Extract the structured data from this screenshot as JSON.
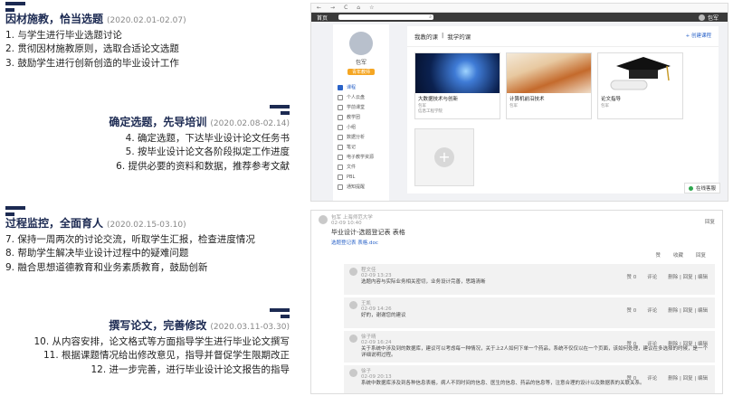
{
  "phases": [
    {
      "title": "因材施教，恰当选题",
      "date": "(2020.02.01-02.07)",
      "items": [
        "1. 与学生进行毕业选题讨论",
        "2. 贯彻因材施教原则，选取合适论文选题",
        "3. 鼓励学生进行创新创造的毕业设计工作"
      ]
    },
    {
      "title": "确定选题，先导培训",
      "date": "(2020.02.08-02.14)",
      "items": [
        "4. 确定选题，下达毕业设计论文任务书",
        "5. 按毕业设计论文各阶段拟定工作进度",
        "6. 提供必要的资料和数据，推荐参考文献"
      ]
    },
    {
      "title": "过程监控，全面育人",
      "date": "(2020.02.15-03.10)",
      "items": [
        "7. 保持一周两次的讨论交流，听取学生汇报，检查进度情况",
        "8. 帮助学生解决毕业设计过程中的疑难问题",
        "9. 融合思想道德教育和业务素质教育，鼓励创新"
      ]
    },
    {
      "title": "撰写论文，完善修改",
      "date": "(2020.03.11-03.30)",
      "items": [
        "10. 从内容安排，论文格式等方面指导学生进行毕业论文撰写",
        "11. 根据课题情况给出修改意见，指导并督促学生限期改正",
        "12. 进一步完善，进行毕业设计论文报告的指导"
      ]
    }
  ],
  "shot1": {
    "toolbar": [
      "←",
      "→",
      "C",
      "⌂",
      "☆"
    ],
    "nav_home": "首页",
    "user_name": "包军",
    "profile_name": "包军",
    "profile_tag": "青年教师",
    "menu": [
      "课程",
      "个人云盘",
      "学前课堂",
      "教学团",
      "小组",
      "数据分析",
      "笔记",
      "电子教学资源",
      "文件",
      "PBL",
      "通知提醒"
    ],
    "tabs": [
      "我教的课",
      "|",
      "我学的课"
    ],
    "add_course": "+ 创建课程",
    "courses": [
      {
        "title": "大数据技术与创新",
        "sub": "包军",
        "sub2": "信息工程学院"
      },
      {
        "title": "计算机前沿技术",
        "sub": "包军",
        "sub2": ""
      },
      {
        "title": "论文指导",
        "sub": "包军",
        "sub2": ""
      }
    ],
    "add_symbol": "+",
    "online_label": "在线客服"
  },
  "shot2": {
    "post": {
      "author": "包军 上海师范大学",
      "date": "02-09 10:40",
      "title": "毕业设计-选题登记表 表格",
      "file": "选题登记表 表格.doc",
      "action": "回复",
      "stats": [
        "赞",
        "收藏",
        "回复"
      ]
    },
    "replies": [
      {
        "author": "程文佳",
        "date": "02-09 13:23",
        "text": "选题内容与实际业务相关密切，业务设计完善，思路清晰",
        "stats": [
          "赞 0",
          "评论",
          "删除 | 回复 | 编辑"
        ]
      },
      {
        "author": "王凯",
        "date": "02-09 14:26",
        "text": "好的，谢谢您的建议",
        "stats": [
          "赞 0",
          "评论",
          "删除 | 回复 | 编辑"
        ]
      },
      {
        "author": "徐子晴",
        "date": "02-09 16:24",
        "text": "关于系统中涉及到的数据库，建议可以考虑每一种情况，关于上2人如何下单一个药品，系统不仅仅以在一个页面，该如何处理，建议在多选择的时候，是一个详细说明过程。",
        "stats": [
          "赞 0",
          "评论",
          "删除 | 回复 | 编辑"
        ]
      },
      {
        "author": "徐子",
        "date": "02-09 20:13",
        "text": "系统中数据库涉及到各种信息表格，病人不同时间的信息、医生的信息、药品的信息等，注意合理的设计以及数据表的关联关系。",
        "stats": [
          "赞 0",
          "评论",
          "删除 | 回复 | 编辑"
        ]
      }
    ]
  }
}
